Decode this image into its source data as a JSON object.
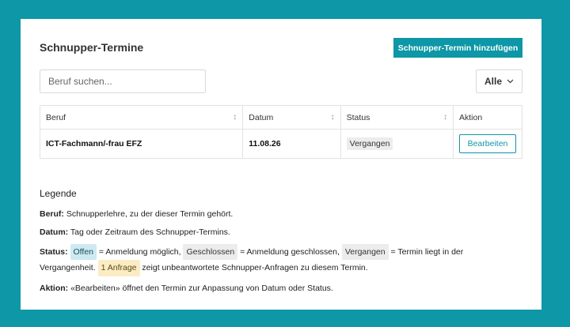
{
  "header": {
    "title": "Schnupper-Termine",
    "add_button": "Schnupper-Termin hinzufügen"
  },
  "search": {
    "placeholder": "Beruf suchen..."
  },
  "filter": {
    "selected": "Alle",
    "icon": "chevron-down-icon"
  },
  "table": {
    "columns": [
      "Beruf",
      "Datum",
      "Status",
      "Aktion"
    ],
    "sort_icon": "sort-icon",
    "rows": [
      {
        "beruf": "ICT-Fachmann/-frau EFZ",
        "datum": "11.08.26",
        "status": "Vergangen",
        "action": "Bearbeiten"
      }
    ]
  },
  "legend": {
    "title": "Legende",
    "beruf_label": "Beruf:",
    "beruf_text": " Schnupperlehre, zu der dieser Termin gehört.",
    "datum_label": "Datum:",
    "datum_text": " Tag oder Zeitraum des Schnupper-Termins.",
    "status_label": "Status:",
    "badge_offen": "Offen",
    "text_offen": " = Anmeldung möglich, ",
    "badge_geschlossen": "Geschlossen",
    "text_geschlossen": " = Anmeldung geschlossen, ",
    "badge_vergangen": "Vergangen",
    "text_vergangen": " = Termin liegt in der Vergangenheit. ",
    "badge_anfrage": "1 Anfrage",
    "text_anfrage": " zeigt unbeantwortete Schnupper-Anfragen zu diesem Termin.",
    "aktion_label": "Aktion:",
    "aktion_text": " «Bearbeiten» öffnet den Termin zur Anpassung von Datum oder Status."
  },
  "colors": {
    "background": "#0e97a6",
    "accent": "#0e97a6",
    "badge_offen": "#cde9f1",
    "badge_anfrage": "#fbecc4",
    "badge_neutral": "#ececec"
  }
}
